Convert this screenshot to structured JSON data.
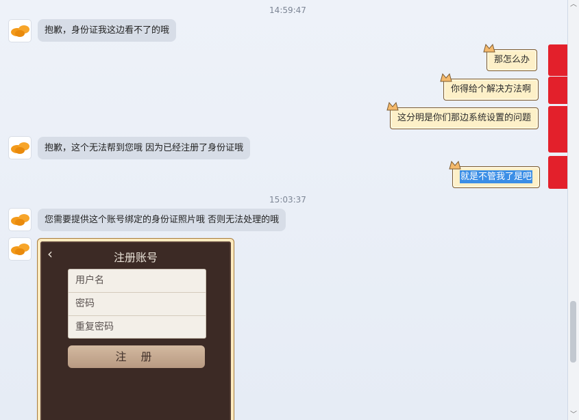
{
  "messages": {
    "ts1": "14:59:47",
    "ts2": "15:03:37",
    "in1": "抱歉，身份证我这边看不了的哦",
    "out1": "那怎么办",
    "out2": "你得给个解决方法啊",
    "out3": "这分明是你们那边系统设置的问题",
    "in2": "抱歉，这个无法帮到您哦 因为已经注册了身份证哦",
    "out4": "就是不管我了是吧",
    "in3": "您需要提供这个账号绑定的身份证照片哦 否则无法处理的哦"
  },
  "screenshot_card": {
    "title": "注册账号",
    "username_placeholder": "用户名",
    "password_placeholder": "密码",
    "repeat_password_placeholder": "重复密码",
    "register_button": "注 册"
  },
  "scrollbar": {
    "up_icon": "chevron-up-icon",
    "down_icon": "chevron-down-icon"
  },
  "colors": {
    "incoming_bubble": "#d7dde7",
    "outgoing_bubble": "#fdf0c8",
    "selection": "#3b8ee6",
    "redaction": "#e3202b"
  }
}
